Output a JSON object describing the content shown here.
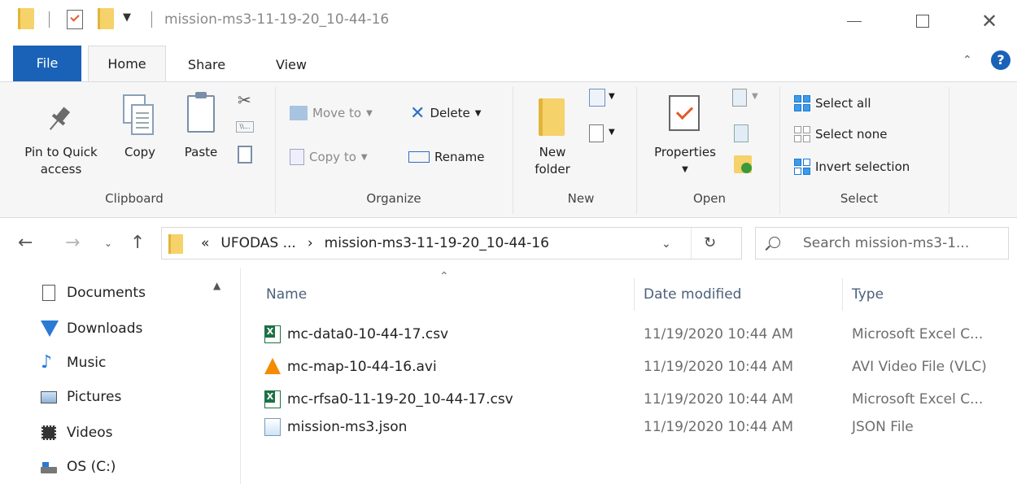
{
  "window": {
    "title": "mission-ms3-11-19-20_10-44-16",
    "quick_access_dropdown": "▕",
    "minimize": "",
    "maximize": "",
    "close": "✕"
  },
  "ribbon_tabs": [
    {
      "label": "File"
    },
    {
      "label": "Home"
    },
    {
      "label": "Share"
    },
    {
      "label": "View"
    }
  ],
  "help_label": "?",
  "clipboard": {
    "pin_label": "Pin to Quick access",
    "pin_line1": "Pin to Quick",
    "pin_line2": "access",
    "copy_label": "Copy",
    "paste_label": "Paste",
    "group_label": "Clipboard"
  },
  "organize": {
    "move_to": "Move to",
    "copy_to": "Copy to",
    "delete": "Delete",
    "rename": "Rename",
    "group_label": "Organize"
  },
  "new": {
    "new_folder_line1": "New",
    "new_folder_line2": "folder",
    "group_label": "New"
  },
  "open": {
    "properties": "Properties",
    "group_label": "Open"
  },
  "select": {
    "select_all": "Select all",
    "select_none": "Select none",
    "invert_selection": "Invert selection",
    "group_label": "Select"
  },
  "address": {
    "overflow": "«",
    "crumb1": "UFODAS ...",
    "sep": "›",
    "crumb2": "mission-ms3-11-19-20_10-44-16"
  },
  "search": {
    "placeholder": "Search mission-ms3-1..."
  },
  "nav_pane": [
    {
      "label": "Documents",
      "icon": "documents-icon"
    },
    {
      "label": "Downloads",
      "icon": "downloads-icon"
    },
    {
      "label": "Music",
      "icon": "music-icon"
    },
    {
      "label": "Pictures",
      "icon": "pictures-icon"
    },
    {
      "label": "Videos",
      "icon": "videos-icon"
    },
    {
      "label": "OS (C:)",
      "icon": "drive-icon"
    }
  ],
  "columns": {
    "name": "Name",
    "date": "Date modified",
    "type": "Type"
  },
  "files": [
    {
      "name": "mc-data0-10-44-17.csv",
      "date": "11/19/2020 10:44 AM",
      "type": "Microsoft Excel C...",
      "icon": "excel-icon"
    },
    {
      "name": "mc-map-10-44-16.avi",
      "date": "11/19/2020 10:44 AM",
      "type": "AVI Video File (VLC)",
      "icon": "vlc-icon"
    },
    {
      "name": "mc-rfsa0-11-19-20_10-44-17.csv",
      "date": "11/19/2020 10:44 AM",
      "type": "Microsoft Excel C...",
      "icon": "excel-icon"
    },
    {
      "name": "mission-ms3.json",
      "date": "11/19/2020 10:44 AM",
      "type": "JSON File",
      "icon": "json-icon"
    }
  ],
  "colors": {
    "accent": "#1a62b7",
    "folder": "#f6d26a",
    "excel": "#1e7145",
    "vlc": "#f48b00"
  }
}
